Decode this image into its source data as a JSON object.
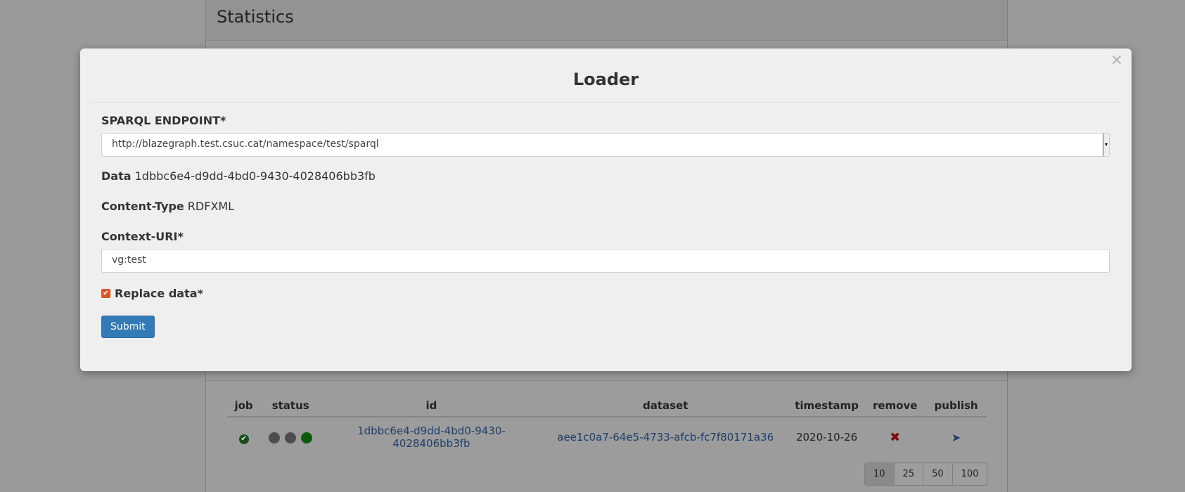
{
  "page": {
    "panel_title": "Statistics"
  },
  "table": {
    "headers": [
      "job",
      "status",
      "id",
      "dataset",
      "timestamp",
      "remove",
      "publish"
    ],
    "rows": [
      {
        "job_icon": "check-circle-icon",
        "status_dots": [
          "gray",
          "gray",
          "green"
        ],
        "id": "1dbbc6e4-d9dd-4bd0-9430-4028406bb3fb",
        "dataset": "aee1c0a7-64e5-4733-afcb-fc7f80171a36",
        "timestamp": "2020-10-26",
        "remove_icon": "remove-x-icon",
        "publish_icon": "send-icon"
      }
    ]
  },
  "pagination": {
    "options": [
      "10",
      "25",
      "50",
      "100"
    ],
    "selected": "10"
  },
  "modal": {
    "title": "Loader",
    "close_glyph": "×",
    "sparql_label": "SPARQL ENDPOINT*",
    "sparql_value": "http://blazegraph.test.csuc.cat/namespace/test/sparql",
    "data_label": "Data",
    "data_value": "1dbbc6e4-d9dd-4bd0-9430-4028406bb3fb",
    "content_type_label": "Content-Type",
    "content_type_value": "RDFXML",
    "context_uri_label": "Context-URI*",
    "context_uri_value": "vg:test",
    "replace_label": "Replace data*",
    "replace_checked": true,
    "submit_label": "Submit"
  },
  "colors": {
    "accent": "#337ab7",
    "checkbox": "#d6582c",
    "status_green": "#0b5c0b",
    "remove_red": "#7a1010"
  }
}
